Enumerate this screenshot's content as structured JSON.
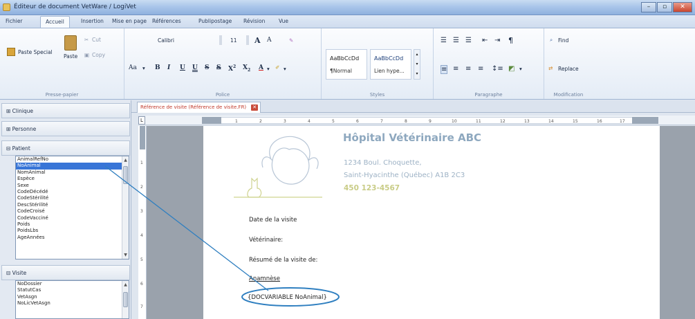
{
  "window": {
    "title": "Éditeur de document VetWare / LogiVet"
  },
  "ribbon": {
    "tabs": [
      "Fichier",
      "Accueil",
      "Insertion",
      "Mise en page",
      "Références",
      "Publipostage",
      "Révision",
      "Vue"
    ],
    "clipboard": {
      "paste_special": "Paste Special",
      "paste": "Paste",
      "cut": "Cut",
      "copy": "Copy",
      "label": "Presse-papier"
    },
    "font": {
      "aa": "Aa",
      "name": "Calibri",
      "size": "11",
      "grow": "A",
      "shrink": "A",
      "bold": "B",
      "italic": "I",
      "underline": "U",
      "double_underline": "U",
      "strike": "S",
      "dstrike": "S",
      "sup": "X",
      "sub": "X",
      "color": "A",
      "label": "Police"
    },
    "styles": {
      "s1_sample": "AaBbCcDd",
      "s1_name": "¶Normal",
      "s2_sample": "AaBbCcDd",
      "s2_name": "Lien hype...",
      "label": "Styles"
    },
    "paragraph": {
      "label": "Paragraphe"
    },
    "editing": {
      "find": "Find",
      "replace": "Replace",
      "label": "Modification"
    }
  },
  "panel": {
    "clinique": "Clinique",
    "personne": "Personne",
    "patient": "Patient",
    "patient_fields": [
      "AnimalRefNo",
      "NoAnimal",
      "NomAnimal",
      "Espèce",
      "Sexe",
      "CodeDécédé",
      "CodeStérilité",
      "DescStérilité",
      "CodeCroisé",
      "CodeVacciné",
      "Poids",
      "PoidsLbs",
      "AgeAnnées"
    ],
    "selected_field": "NoAnimal",
    "visite": "Visite",
    "visite_fields": [
      "NoDossier",
      "StatutCas",
      "VetAsgn",
      "NoLicVetAsgn"
    ]
  },
  "document": {
    "tab_title": "Référence de visite (Référence de visite.FR)",
    "hospital_name": "Hôpital Vétérinaire ABC",
    "address1": "1234 Boul. Choquette,",
    "address2": "Saint-Hyacinthe (Québec)  A1B 2C3",
    "phone": "450 123-4567",
    "fields": {
      "date": "Date de la visite",
      "vet": "Vétérinaire:",
      "summary": "Résumé de la visite de:",
      "anamnese": "Anamnèse",
      "docvariable": "{DOCVARIABLE NoAnimal}"
    }
  },
  "colors": {
    "accent": "#3875d7",
    "annotation": "#2f7fc0",
    "hospital": "#8ea8bf",
    "phone": "#c9cc87"
  }
}
